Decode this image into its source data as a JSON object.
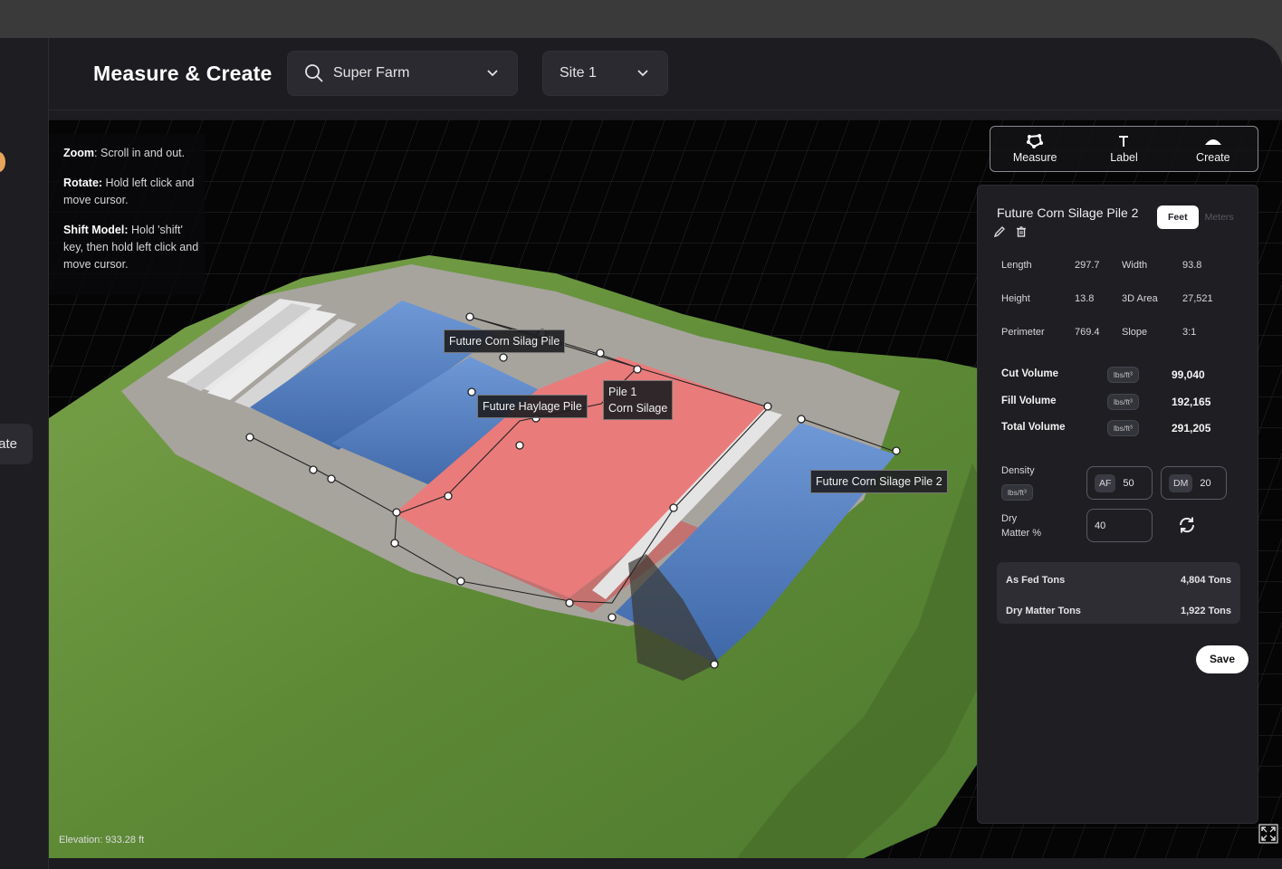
{
  "header": {
    "title": "Measure & Create",
    "farm_select": "Super Farm",
    "site_select": "Site 1"
  },
  "sidebar": {
    "create_label": "Create"
  },
  "help": {
    "zoom_key": "Zoom",
    "zoom_text": ": Scroll in and out.",
    "rotate_key": "Rotate:",
    "rotate_text": " Hold left click and move cursor.",
    "shift_key": "Shift Model:",
    "shift_text": " Hold 'shift' key, then hold left click and move cursor."
  },
  "viewport": {
    "elevation": "Elevation: 933.28 ft",
    "labels": {
      "corn1": "Future Corn Silag Pile",
      "haylage": "Future Haylage Pile",
      "pile1_line1": "Pile 1",
      "pile1_line2": "Corn Silage",
      "corn2": "Future Corn Silage Pile 2"
    }
  },
  "tools": {
    "measure": "Measure",
    "label": "Label",
    "create": "Create"
  },
  "panel": {
    "title": "Future Corn Silage Pile 2",
    "unit_active": "Feet",
    "unit_inactive": "Meters",
    "stats": [
      {
        "k1": "Length",
        "v1": "297.7",
        "k2": "Width",
        "v2": "93.8"
      },
      {
        "k1": "Height",
        "v1": "13.8",
        "k2": "3D Area",
        "v2": "27,521"
      },
      {
        "k1": "Perimeter",
        "v1": "769.4",
        "k2": "Slope",
        "v2": "3:1"
      }
    ],
    "volumes": [
      {
        "label": "Cut Volume",
        "unit": "lbs/ft³",
        "value": "99,040"
      },
      {
        "label": "Fill Volume",
        "unit": "lbs/ft³",
        "value": "192,165"
      },
      {
        "label": "Total Volume",
        "unit": "lbs/ft³",
        "value": "291,205"
      }
    ],
    "density_label": "Density",
    "density_unit": "lbs/ft³",
    "af_chip": "AF",
    "af_value": "50",
    "dm_chip": "DM",
    "dm_value": "20",
    "dry_label_1": "Dry",
    "dry_label_2": "Matter %",
    "dry_value": "40",
    "as_fed_label": "As Fed Tons",
    "as_fed_value": "4,804 Tons",
    "dry_tons_label": "Dry Matter Tons",
    "dry_tons_value": "1,922 Tons",
    "save": "Save"
  },
  "colors": {
    "accent_pile": "#f06b6b",
    "cover_blue": "#4f7fc4",
    "grass": "#6e9a3e"
  }
}
